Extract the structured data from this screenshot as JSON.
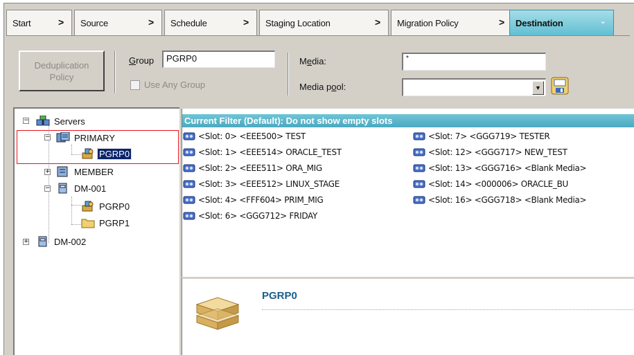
{
  "tabs": [
    {
      "label": "Start",
      "active": false
    },
    {
      "label": "Source",
      "active": false
    },
    {
      "label": "Schedule",
      "active": false
    },
    {
      "label": "Staging Location",
      "active": false
    },
    {
      "label": "Migration Policy",
      "active": false
    },
    {
      "label": "Destination",
      "active": true
    }
  ],
  "tab_arrow": ">",
  "tab_chevron": "⌄",
  "options": {
    "dedup_button": "Deduplication\nPolicy",
    "group_label_u": "G",
    "group_label_rest": "roup",
    "group_value": "PGRP0",
    "use_any_group": "Use Any Group",
    "media_label_pre": "M",
    "media_label_u": "e",
    "media_label_post": "dia:",
    "media_value": "*",
    "media_pool_label_pre": "Media p",
    "media_pool_label_u": "o",
    "media_pool_label_post": "ol:",
    "media_pool_value": ""
  },
  "tree": {
    "root": "Servers",
    "nodes": [
      "PRIMARY",
      "PGRP0",
      "MEMBER",
      "DM-001",
      "PGRP0",
      "PGRP1",
      "DM-002"
    ]
  },
  "filter_text": "Current Filter (Default):  Do not show empty slots",
  "slots_left": [
    "<Slot: 0> <EEE500> TEST",
    "<Slot: 1> <EEE514> ORACLE_TEST",
    "<Slot: 2> <EEE511> ORA_MIG",
    "<Slot: 3> <EEE512> LINUX_STAGE",
    "<Slot: 4> <FFF604> PRIM_MIG",
    "<Slot: 6> <GGG712> FRIDAY"
  ],
  "slots_right": [
    "<Slot: 7> <GGG719> TESTER",
    "<Slot: 12> <GGG717> NEW_TEST",
    "<Slot: 13> <GGG716> <Blank Media>",
    "<Slot: 14> <000006> ORACLE_BU",
    "<Slot: 16> <GGG718> <Blank Media>"
  ],
  "detail_title": "PGRP0",
  "colors": {
    "active_tab": "#61bfd2",
    "filter_bar": "#4ba9c0",
    "selection": "#0a246a",
    "highlight_box": "#e0141e",
    "detail_title": "#1b5f8c"
  }
}
